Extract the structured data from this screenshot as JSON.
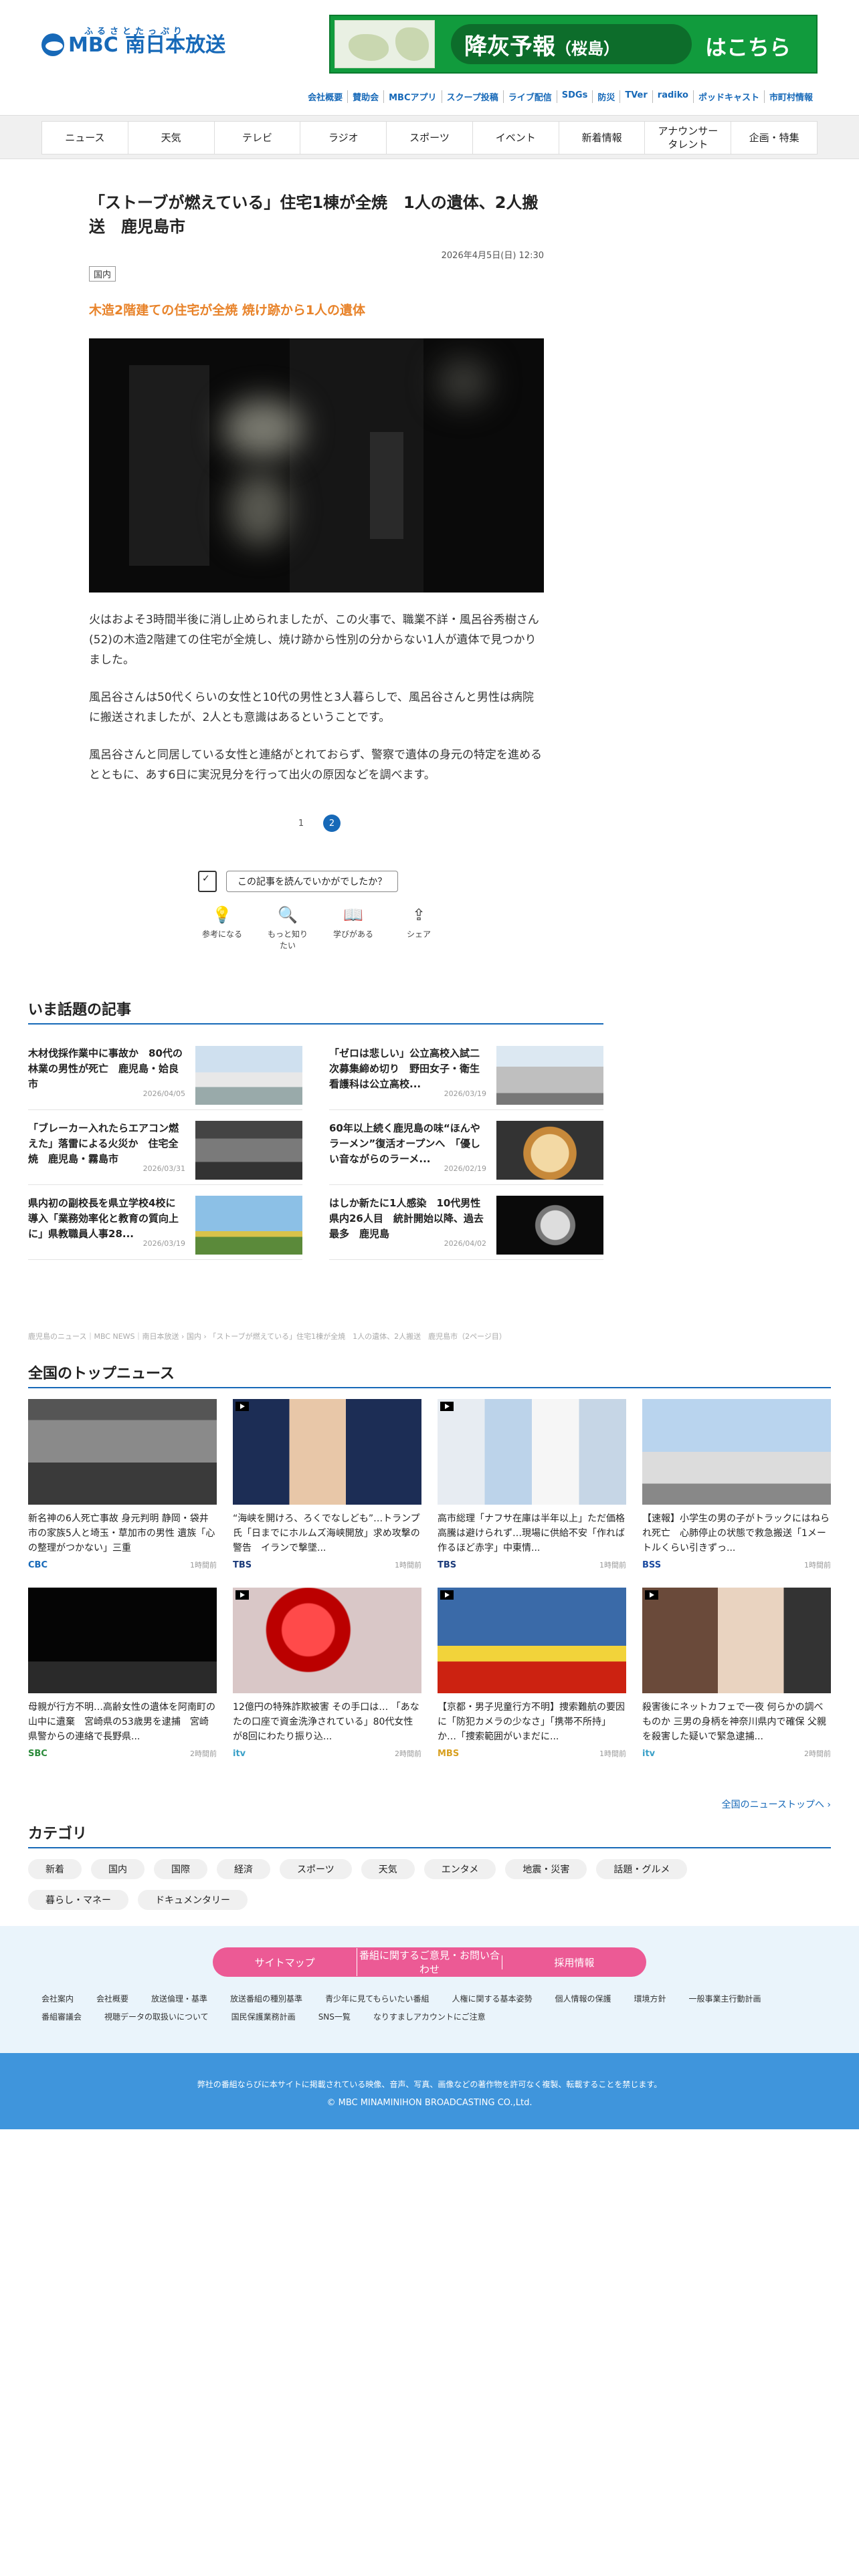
{
  "header": {
    "logo_kana": "ふるさとたっぷり",
    "logo_text": "MBC 南日本放送",
    "banner_main": "降灰予報",
    "banner_sub": "（桜島）",
    "banner_link": "はこちら",
    "util_links": [
      "会社概要",
      "賛助会",
      "MBCアプリ",
      "スクープ投稿",
      "ライブ配信",
      "SDGs",
      "防災",
      "TVer",
      "radiko",
      "ポッドキャスト",
      "市町村情報"
    ]
  },
  "nav": [
    "ニュース",
    "天気",
    "テレビ",
    "ラジオ",
    "スポーツ",
    "イベント",
    "新着情報",
    "アナウンサー\nタレント",
    "企画・特集"
  ],
  "article": {
    "title": "「ストーブが燃えている」住宅1棟が全焼　1人の遺体、2人搬送　鹿児島市",
    "date": "2026年4月5日(日) 12:30",
    "category": "国内",
    "subtitle": "木造2階建ての住宅が全焼 焼け跡から1人の遺体",
    "paragraphs": [
      "火はおよそ3時間半後に消し止められましたが、この火事で、職業不詳・風呂谷秀樹さん(52)の木造2階建ての住宅が全焼し、焼け跡から性別の分からない1人が遺体で見つかりました。",
      "風呂谷さんは50代くらいの女性と10代の男性と3人暮らしで、風呂谷さんと男性は病院に搬送されましたが、2人とも意識はあるということです。",
      "風呂谷さんと同居している女性と連絡がとれておらず、警察で遺体の身元の特定を進めるとともに、あす6日に実況見分を行って出火の原因などを調べます。"
    ],
    "pages": [
      "1",
      "2"
    ],
    "active_page": "2"
  },
  "feedback": {
    "question": "この記事を読んでいかがでしたか？",
    "actions": [
      "参考になる",
      "もっと知りたい",
      "学びがある",
      "シェア"
    ]
  },
  "trending": {
    "title": "いま話題の記事",
    "items": [
      {
        "text": "木材伐採作業中に事故か　80代の林業の男性が死亡　鹿児島・姶良市",
        "date": "2026/04/05"
      },
      {
        "text": "「ゼロは悲しい」公立高校入試二次募集締め切り　野田女子・衛生看護科は公立高校...",
        "date": "2026/03/19"
      },
      {
        "text": "「ブレーカー入れたらエアコン燃えた」落雷による火災か　住宅全焼　鹿児島・霧島市",
        "date": "2026/03/31"
      },
      {
        "text": "60年以上続く鹿児島の味“ほんやラーメン”復活オープンへ　「優しい音ながらのラーメ...",
        "date": "2026/02/19"
      },
      {
        "text": "県内初の副校長を県立学校4校に導入「業務効率化と教育の質向上に」県教職員人事28...",
        "date": "2026/03/19"
      },
      {
        "text": "はしか新たに1人感染　10代男性　県内26人目　統計開始以降、過去最多　鹿児島",
        "date": "2026/04/02"
      }
    ]
  },
  "breadcrumb": "鹿児島のニュース｜MBC NEWS｜南日本放送 › 国内 › 「ストーブが燃えている」住宅1棟が全焼　1人の遺体、2人搬送　鹿児島市（2ページ目）",
  "national": {
    "title": "全国のトップニュース",
    "items": [
      {
        "text": "新名神の6人死亡事故 身元判明 静岡・袋井市の家族5人と埼玉・草加市の男性 遺族「心の整理がつかない」三重",
        "src": "CBC",
        "time": "1時間前"
      },
      {
        "text": "“海峡を開けろ、ろくでなしども”…トランプ氏「日までにホルムズ海峡開放」求め攻撃の警告　イランで撃墜...",
        "src": "TBS",
        "time": "1時間前"
      },
      {
        "text": "高市総理「ナフサ在庫は半年以上」ただ価格高騰は避けられず…現場に供給不安「作れば作るほど赤字」中東情...",
        "src": "TBS",
        "time": "1時間前"
      },
      {
        "text": "【速報】小学生の男の子がトラックにはねられ死亡　心肺停止の状態で救急搬送「1メートルくらい引きずっ...",
        "src": "BSS",
        "time": "1時間前"
      },
      {
        "text": "母親が行方不明…高齢女性の遺体を阿南町の山中に遺棄　宮崎県の53歳男を逮捕　宮崎県警からの連絡で長野県...",
        "src": "SBC",
        "time": "2時間前"
      },
      {
        "text": "12億円の特殊詐欺被害 その手口は… 「あなたの口座で資金洗浄されている」80代女性が8回にわたり振り込...",
        "src": "itv",
        "time": "2時間前"
      },
      {
        "text": "【京都・男子児童行方不明】捜索難航の要因に「防犯カメラの少なさ」「携帯不所持」か…「捜索範囲がいまだに...",
        "src": "MBS",
        "time": "1時間前"
      },
      {
        "text": "殺害後にネットカフェで一夜 何らかの調べものか 三男の身柄を神奈川県内で確保 父親を殺害した疑いで緊急逮捕...",
        "src": "itv",
        "time": "2時間前"
      }
    ],
    "more": "全国のニューストップへ ›"
  },
  "categories": {
    "title": "カテゴリ",
    "items": [
      "新着",
      "国内",
      "国際",
      "経済",
      "スポーツ",
      "天気",
      "エンタメ",
      "地震・災害",
      "話題・グルメ",
      "暮らし・マネー",
      "ドキュメンタリー"
    ]
  },
  "footer": {
    "pink_links": [
      "サイトマップ",
      "番組に関するご意見・お問い合わせ",
      "採用情報"
    ],
    "links": [
      "会社案内",
      "会社概要",
      "放送倫理・基準",
      "放送番組の種別基準",
      "青少年に見てもらいたい番組",
      "人権に関する基本姿勢",
      "個人情報の保護",
      "環境方針",
      "一般事業主行動計画",
      "番組審議会",
      "視聴データの取扱いについて",
      "国民保護業務計画",
      "SNS一覧",
      "なりすましアカウントにご注意"
    ],
    "notice": "弊社の番組ならびに本サイトに掲載されている映像、音声、写真、画像などの著作物を許可なく複製、転載することを禁じます。",
    "copyright": "© MBC MINAMINIHON BROADCASTING CO.,Ltd."
  }
}
